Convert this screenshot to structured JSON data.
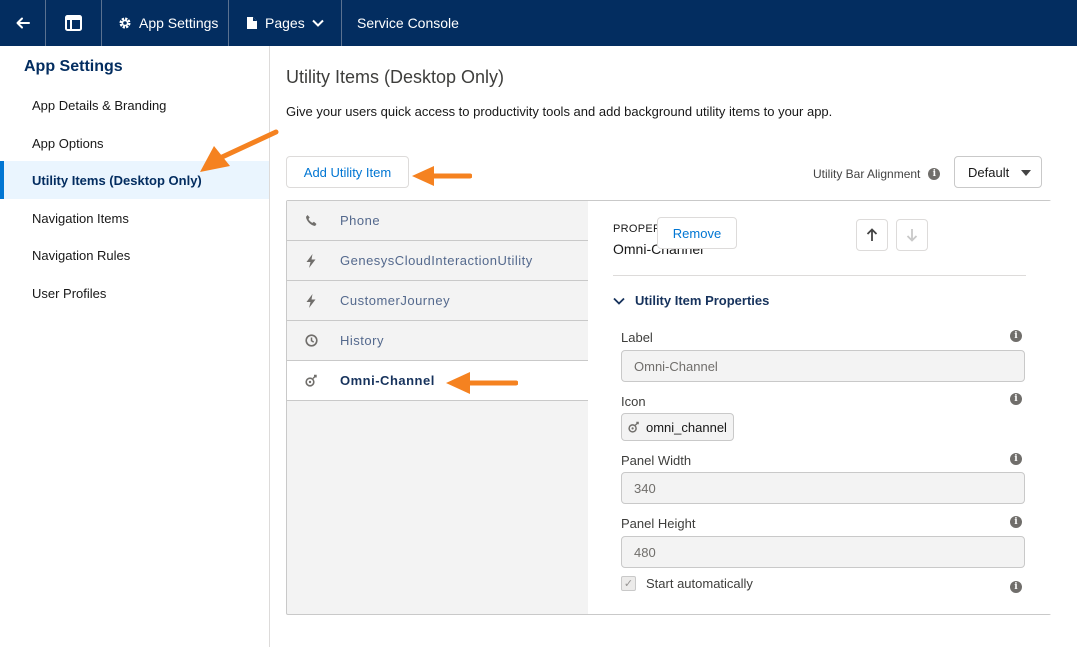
{
  "topbar": {
    "back_icon": "arrow-left-icon",
    "layout_icon": "layout-icon",
    "settings_label": "App Settings",
    "pages_label": "Pages",
    "app_name": "Service Console"
  },
  "sidebar": {
    "title": "App Settings",
    "items": [
      {
        "label": "App Details & Branding"
      },
      {
        "label": "App Options"
      },
      {
        "label": "Utility Items (Desktop Only)"
      },
      {
        "label": "Navigation Items"
      },
      {
        "label": "Navigation Rules"
      },
      {
        "label": "User Profiles"
      }
    ]
  },
  "main": {
    "title": "Utility Items (Desktop Only)",
    "description": "Give your users quick access to productivity tools and add background utility items to your app.",
    "add_button": "Add Utility Item",
    "alignment_label": "Utility Bar Alignment",
    "alignment_value": "Default"
  },
  "utility_items": [
    {
      "icon": "phone-icon",
      "label": "Phone"
    },
    {
      "icon": "lightning-icon",
      "label": "GenesysCloudInteractionUtility"
    },
    {
      "icon": "lightning-icon",
      "label": "CustomerJourney"
    },
    {
      "icon": "clock-icon",
      "label": "History"
    },
    {
      "icon": "omni-channel-icon",
      "label": "Omni-Channel"
    }
  ],
  "properties": {
    "header": "PROPERTIES",
    "item_name": "Omni-Channel",
    "remove_button": "Remove",
    "section_title": "Utility Item Properties",
    "label_field": {
      "label": "Label",
      "value": "Omni-Channel"
    },
    "icon_field": {
      "label": "Icon",
      "value": "omni_channel"
    },
    "panel_width": {
      "label": "Panel Width",
      "value": "340"
    },
    "panel_height": {
      "label": "Panel Height",
      "value": "480"
    },
    "start_auto": {
      "label": "Start automatically",
      "checked": true
    }
  },
  "colors": {
    "topbar": "#032d60",
    "accent": "#0176d3",
    "annotation_arrow": "#f58220"
  }
}
